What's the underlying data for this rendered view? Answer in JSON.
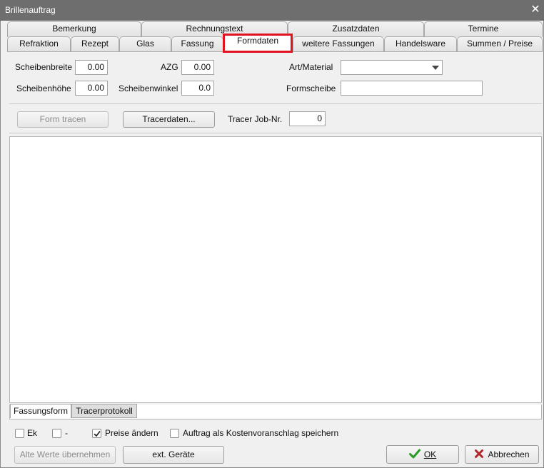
{
  "window": {
    "title": "Brillenauftrag"
  },
  "tabs_back": [
    {
      "label": "Bemerkung"
    },
    {
      "label": "Rechnungstext"
    },
    {
      "label": "Zusatzdaten"
    },
    {
      "label": "Termine"
    }
  ],
  "tabs_front": [
    {
      "label": "Refraktion"
    },
    {
      "label": "Rezept"
    },
    {
      "label": "Glas"
    },
    {
      "label": "Fassung"
    },
    {
      "label": "Formdaten"
    },
    {
      "label": "weitere Fassungen"
    },
    {
      "label": "Handelsware"
    },
    {
      "label": "Summen / Preise"
    }
  ],
  "form": {
    "scheibenbreite_label": "Scheibenbreite",
    "scheibenbreite_value": "0.00",
    "azg_label": "AZG",
    "azg_value": "0.00",
    "art_material_label": "Art/Material",
    "art_material_value": "",
    "scheibenhoehe_label": "Scheibenhöhe",
    "scheibenhoehe_value": "0.00",
    "scheibenwinkel_label": "Scheibenwinkel",
    "scheibenwinkel_value": "0.0",
    "formscheibe_label": "Formscheibe",
    "formscheibe_value": ""
  },
  "tracer": {
    "form_tracen_label": "Form tracen",
    "tracerdaten_label": "Tracerdaten...",
    "job_nr_label": "Tracer Job-Nr.",
    "job_nr_value": "0"
  },
  "subtabs": [
    {
      "label": "Fassungsform"
    },
    {
      "label": "Tracerprotokoll"
    }
  ],
  "options": {
    "ek_label": "Ek",
    "dash_label": "-",
    "preise_aendern_label": "Preise ändern",
    "kostenvoranschlag_label": "Auftrag als Kostenvoranschlag speichern"
  },
  "footer": {
    "alte_werte_label": "Alte Werte übernehmen",
    "ext_geraete_label": "ext. Geräte",
    "ok_label": "OK",
    "abbrechen_label": "Abbrechen"
  },
  "colors": {
    "active_tab_border": "#e0141e",
    "ok_check": "#2a9a24",
    "cancel_x": "#b3262b"
  }
}
